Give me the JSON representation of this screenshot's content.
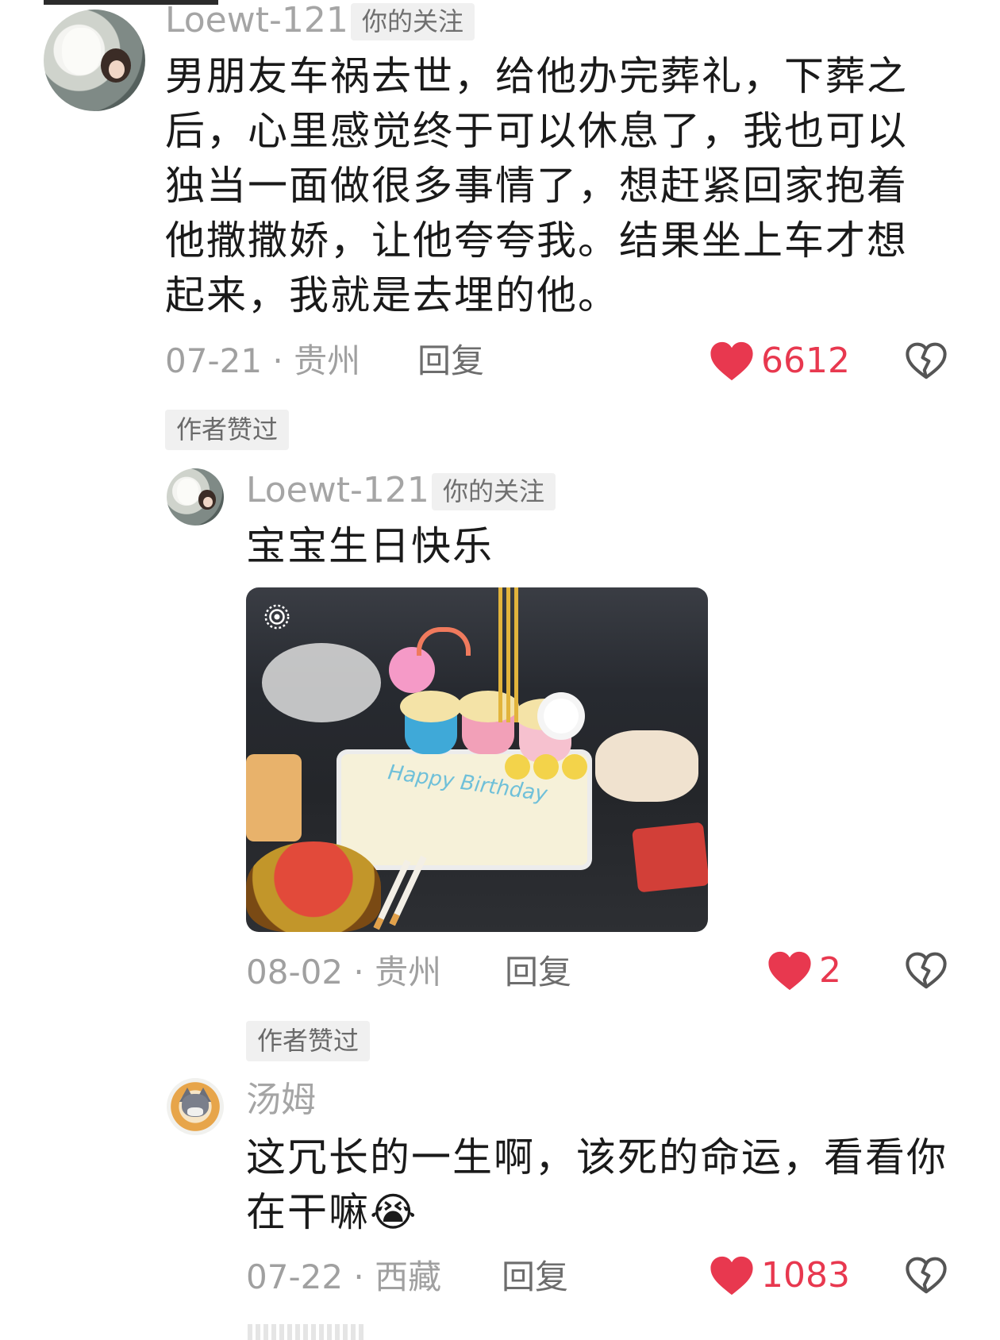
{
  "comments": [
    {
      "username": "Loewt-121",
      "follow_tag": "你的关注",
      "text_lines": [
        "男朋友车祸去世，给他办完葬礼，下葬之",
        "后，心里感觉终于可以休息了，我也可以",
        "独当一面做很多事情了，想赶紧回家抱着",
        "他撒撒娇，让他夸夸我。结果坐上车才想",
        "起来，我就是去埋的他。"
      ],
      "meta": "07-21 · 贵州",
      "reply_label": "回复",
      "likes": "6612",
      "author_liked": "作者赞过"
    },
    {
      "username": "Loewt-121",
      "follow_tag": "你的关注",
      "text": "宝宝生日快乐",
      "photo_text": "Happy Birthday",
      "meta": "08-02 · 贵州",
      "reply_label": "回复",
      "likes": "2",
      "author_liked": "作者赞过"
    },
    {
      "username": "汤姆",
      "text_lines": [
        "这冗长的一生啊，该死的命运，看看你",
        "在干嘛😭"
      ],
      "meta": "07-22 · 西藏",
      "reply_label": "回复",
      "likes": "1083"
    }
  ],
  "colors": {
    "like_red": "#e8384f",
    "meta_gray": "#a0a0a0",
    "tag_bg": "#f0f0f0"
  }
}
